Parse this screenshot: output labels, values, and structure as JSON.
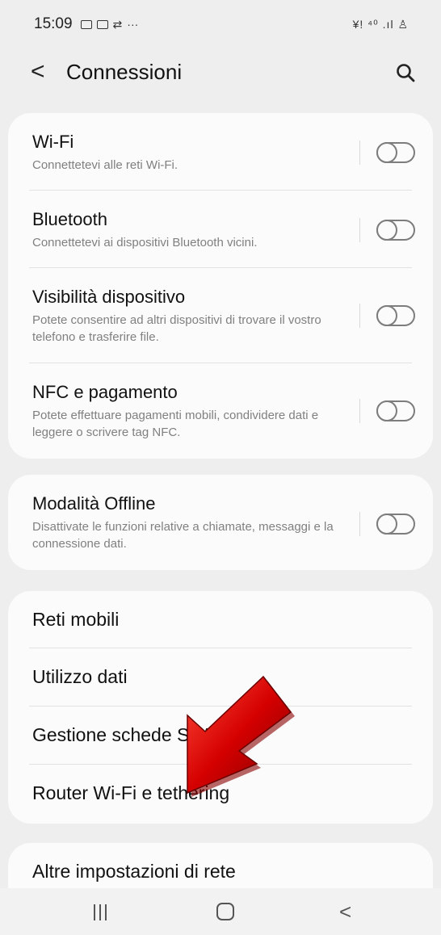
{
  "status_bar": {
    "time": "15:09",
    "left_icons": [
      "gallery-icon",
      "image-icon",
      "arrows-icon",
      "more-dots-icon"
    ],
    "right_icons": "¥ǃ ⁴⁰ .ıl ♙"
  },
  "app_bar": {
    "back_glyph": "<",
    "title": "Connessioni"
  },
  "group1": [
    {
      "title": "Wi-Fi",
      "subtitle": "Connettetevi alle reti Wi-Fi.",
      "toggle": "off"
    },
    {
      "title": "Bluetooth",
      "subtitle": "Connettetevi ai dispositivi Bluetooth vicini.",
      "toggle": "off"
    },
    {
      "title": "Visibilità dispositivo",
      "subtitle": "Potete consentire ad altri dispositivi di trovare il vostro telefono e trasferire file.",
      "toggle": "off"
    },
    {
      "title": "NFC e pagamento",
      "subtitle": "Potete effettuare pagamenti mobili, condividere dati e leggere o scrivere tag NFC.",
      "toggle": "off"
    }
  ],
  "group2": [
    {
      "title": "Modalità Offline",
      "subtitle": "Disattivate le funzioni relative a chiamate, messaggi e la connessione dati.",
      "toggle": "off"
    }
  ],
  "group3": [
    {
      "title": "Reti mobili"
    },
    {
      "title": "Utilizzo dati"
    },
    {
      "title": "Gestione schede SIM"
    },
    {
      "title": "Router Wi-Fi e tethering"
    }
  ],
  "group4": [
    {
      "title": "Altre impostazioni di rete"
    }
  ],
  "nav_bar": {
    "back_glyph": "<"
  },
  "colors": {
    "background": "#eeeeee",
    "card": "#fbfbfb",
    "subtitle": "#808080",
    "arrow_red": "#d40000"
  }
}
